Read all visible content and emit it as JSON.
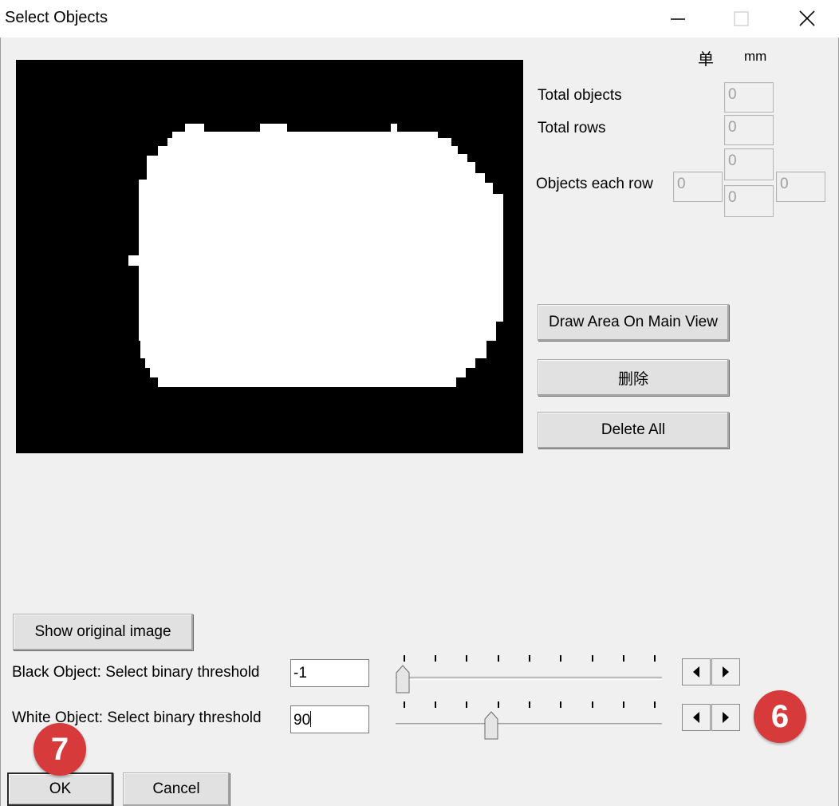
{
  "window": {
    "title": "Select Objects"
  },
  "units": {
    "symbol": "单",
    "mm": "mm"
  },
  "stats": {
    "total_objects_label": "Total objects",
    "total_objects": "0",
    "total_rows_label": "Total rows",
    "total_rows": "0",
    "objects_each_row_label": "Objects each row",
    "each_row_left": "0",
    "each_row_top": "0",
    "each_row_bottom": "0",
    "each_row_right": "0"
  },
  "buttons": {
    "draw_area": "Draw Area On Main View",
    "delete": "删除",
    "delete_all": "Delete All",
    "show_original": "Show original image",
    "ok": "OK",
    "cancel": "Cancel"
  },
  "thresholds": {
    "black_label": "Black Object: Select binary threshold",
    "black_value": "-1",
    "black_slider_fraction": 0.0,
    "white_label": "White Object: Select binary threshold",
    "white_value": "90",
    "white_slider_fraction": 0.35
  },
  "annotations": {
    "badge_6": "6",
    "badge_7": "7"
  },
  "colors": {
    "preview_bg": "#000000",
    "preview_object": "#ffffff",
    "badge": "#d63a3a"
  }
}
